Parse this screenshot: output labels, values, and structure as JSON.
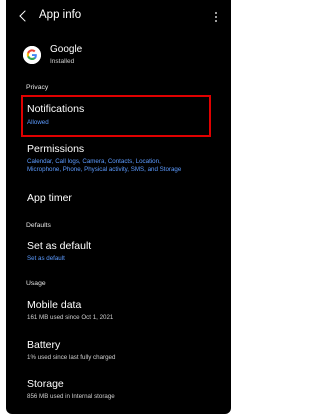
{
  "header": {
    "title": "App info"
  },
  "app": {
    "name": "Google",
    "status": "Installed"
  },
  "sections": {
    "privacy": "Privacy",
    "defaults": "Defaults",
    "usage": "Usage"
  },
  "items": {
    "notifications": {
      "title": "Notifications",
      "subtitle": "Allowed"
    },
    "permissions": {
      "title": "Permissions",
      "subtitle_line1": "Calendar, Call logs, Camera, Contacts, Location,",
      "subtitle_line2": "Microphone, Phone, Physical activity, SMS, and Storage"
    },
    "app_timer": {
      "title": "App timer"
    },
    "set_default": {
      "title": "Set as default",
      "subtitle": "Set as default"
    },
    "mobile_data": {
      "title": "Mobile data",
      "subtitle": "161 MB used since Oct 1, 2021"
    },
    "battery": {
      "title": "Battery",
      "subtitle": "1% used since last fully charged"
    },
    "storage": {
      "title": "Storage",
      "subtitle": "856 MB used in Internal storage"
    }
  },
  "colors": {
    "background": "#000000",
    "accent_blue": "#5c9bff",
    "highlight_red": "#e00000"
  },
  "icons": {
    "back": "back-arrow-icon",
    "more": "more-options-icon",
    "app_logo": "google-logo-icon"
  }
}
